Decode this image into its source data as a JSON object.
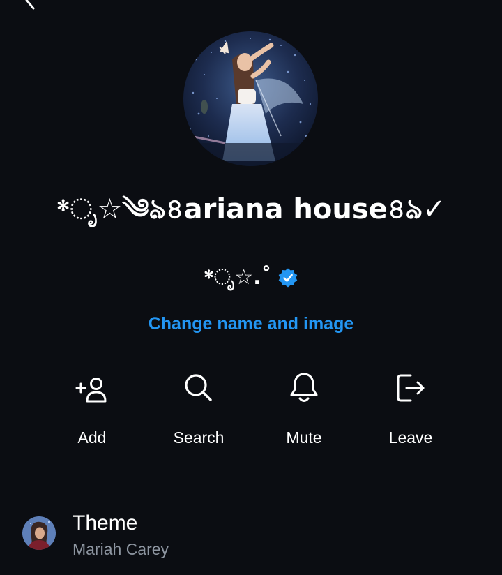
{
  "header": {
    "back_icon": "chevron-left-icon"
  },
  "group": {
    "avatar_icon": "group-photo",
    "name": "*ೃ☆༄ঌ৪ariana house৪ঌ✓",
    "creator": "*ೃ☆.˚",
    "verified_icon": "verified-badge-icon",
    "verified_color": "#2396f3"
  },
  "change_link": "Change name and image",
  "actions": [
    {
      "label": "Add",
      "icon": "add-person-icon"
    },
    {
      "label": "Search",
      "icon": "search-icon"
    },
    {
      "label": "Mute",
      "icon": "bell-icon"
    },
    {
      "label": "Leave",
      "icon": "leave-icon"
    }
  ],
  "theme": {
    "title": "Theme",
    "subtitle": "Mariah Carey",
    "thumb_icon": "theme-photo"
  },
  "colors": {
    "background": "#0b0d12",
    "accent": "#2396f3",
    "secondary_text": "#8e96a1"
  }
}
